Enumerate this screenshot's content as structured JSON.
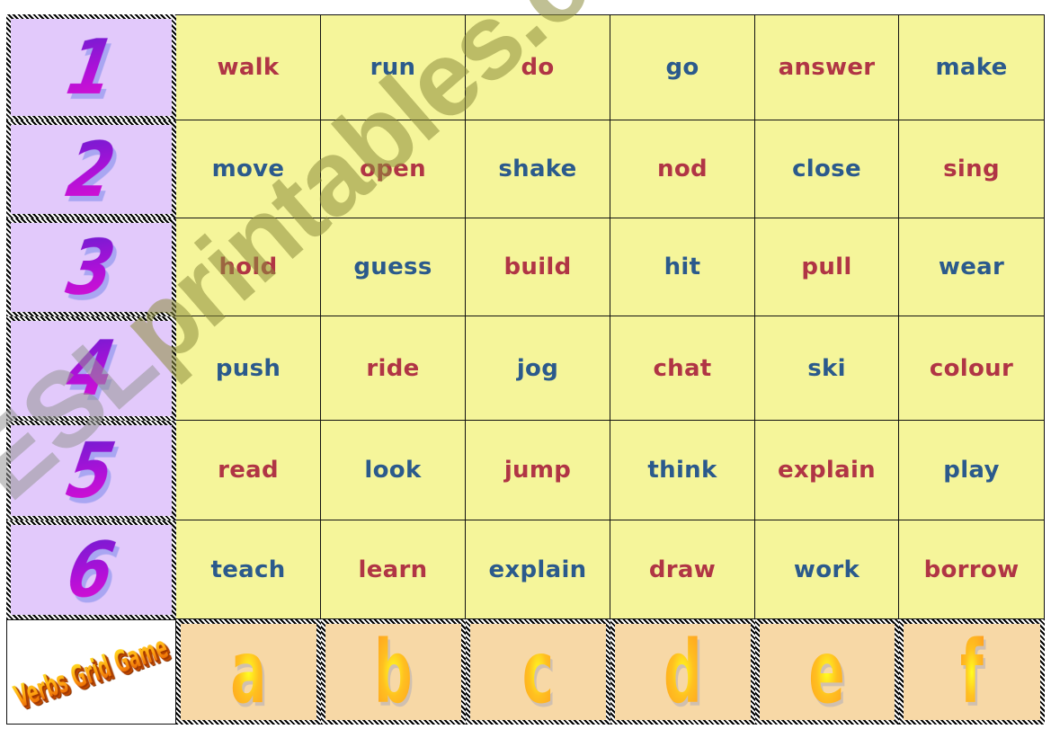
{
  "game": {
    "title": "Verbs Grid Game",
    "row_labels": [
      "1",
      "2",
      "3",
      "4",
      "5",
      "6"
    ],
    "column_labels": [
      "a",
      "b",
      "c",
      "d",
      "e",
      "f"
    ],
    "rows": [
      {
        "row": "1",
        "cells": [
          {
            "word": "walk",
            "color": "red"
          },
          {
            "word": "run",
            "color": "blue"
          },
          {
            "word": "do",
            "color": "red"
          },
          {
            "word": "go",
            "color": "blue"
          },
          {
            "word": "answer",
            "color": "red"
          },
          {
            "word": "make",
            "color": "blue"
          }
        ]
      },
      {
        "row": "2",
        "cells": [
          {
            "word": "move",
            "color": "blue"
          },
          {
            "word": "open",
            "color": "red"
          },
          {
            "word": "shake",
            "color": "blue"
          },
          {
            "word": "nod",
            "color": "red"
          },
          {
            "word": "close",
            "color": "blue"
          },
          {
            "word": "sing",
            "color": "red"
          }
        ]
      },
      {
        "row": "3",
        "cells": [
          {
            "word": "hold",
            "color": "red"
          },
          {
            "word": "guess",
            "color": "blue"
          },
          {
            "word": "build",
            "color": "red"
          },
          {
            "word": "hit",
            "color": "blue"
          },
          {
            "word": "pull",
            "color": "red"
          },
          {
            "word": "wear",
            "color": "blue"
          }
        ]
      },
      {
        "row": "4",
        "cells": [
          {
            "word": "push",
            "color": "blue"
          },
          {
            "word": "ride",
            "color": "red"
          },
          {
            "word": "jog",
            "color": "blue"
          },
          {
            "word": "chat",
            "color": "red"
          },
          {
            "word": "ski",
            "color": "blue"
          },
          {
            "word": "colour",
            "color": "red"
          }
        ]
      },
      {
        "row": "5",
        "cells": [
          {
            "word": "read",
            "color": "red"
          },
          {
            "word": "look",
            "color": "blue"
          },
          {
            "word": "jump",
            "color": "red"
          },
          {
            "word": "think",
            "color": "blue"
          },
          {
            "word": "explain",
            "color": "red"
          },
          {
            "word": "play",
            "color": "blue"
          }
        ]
      },
      {
        "row": "6",
        "cells": [
          {
            "word": "teach",
            "color": "blue"
          },
          {
            "word": "learn",
            "color": "red"
          },
          {
            "word": "explain",
            "color": "blue"
          },
          {
            "word": "draw",
            "color": "red"
          },
          {
            "word": "work",
            "color": "blue"
          },
          {
            "word": "borrow",
            "color": "red"
          }
        ]
      }
    ]
  },
  "watermark": {
    "part_a": "ESL",
    "part_b": "printables.com"
  },
  "colors": {
    "red_word": "#b03545",
    "blue_word": "#2b5a8c",
    "word_cell_bg": "#f5f59a",
    "row_label_bg": "#e2c9fb",
    "column_label_bg": "#f7d8a6"
  }
}
